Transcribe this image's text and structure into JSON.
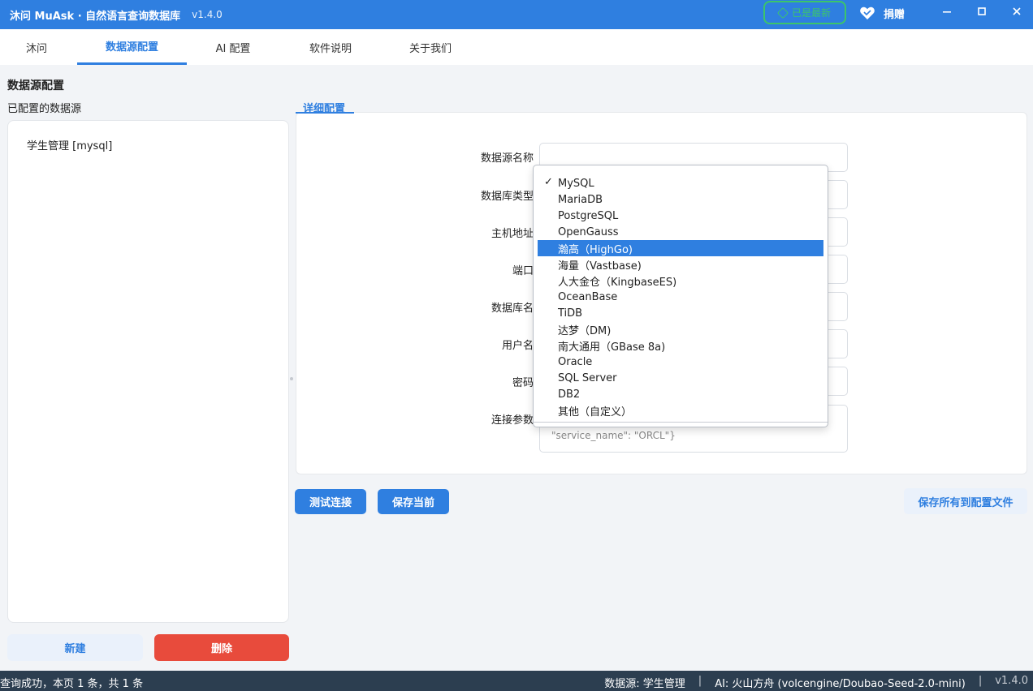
{
  "titlebar": {
    "title": "沐问 MuAsk · 自然语言查询数据库",
    "version": "v1.4.0",
    "update_badge": "已是最新",
    "donate_label": "捐赠"
  },
  "tabs": [
    {
      "label": "沐问"
    },
    {
      "label": "数据源配置"
    },
    {
      "label": "AI 配置"
    },
    {
      "label": "软件说明"
    },
    {
      "label": "关于我们"
    }
  ],
  "left": {
    "section_title": "数据源配置",
    "list_title": "已配置的数据源",
    "items": [
      {
        "label": "学生管理 [mysql]"
      }
    ],
    "new_button": "新建",
    "delete_button": "删除"
  },
  "detail": {
    "group_title": "详细配置",
    "labels": {
      "name": "数据源名称",
      "db_type": "数据库类型",
      "host": "主机地址",
      "port": "端口",
      "db_name": "数据库名",
      "username": "用户名",
      "password": "密码",
      "params": "连接参数"
    },
    "params_placeholder": "\"service_name\": \"ORCL\"}"
  },
  "dropdown": {
    "selected": "MySQL",
    "highlighted": "瀚高（HighGo)",
    "options": [
      "MySQL",
      "MariaDB",
      "PostgreSQL",
      "OpenGauss",
      "瀚高（HighGo)",
      "海量（Vastbase)",
      "人大金仓（KingbaseES)",
      "OceanBase",
      "TiDB",
      "达梦（DM)",
      "南大通用（GBase 8a)",
      "Oracle",
      "SQL Server",
      "DB2",
      "其他（自定义）"
    ]
  },
  "actions": {
    "test_connection": "测试连接",
    "save_current": "保存当前",
    "save_all": "保存所有到配置文件"
  },
  "statusbar": {
    "message": "查询成功，本页 1 条，共 1 条",
    "datasource": "数据源: 学生管理",
    "ai": "AI: 火山方舟 (volcengine/Doubao-Seed-2.0-mini)",
    "version": "v1.4.0",
    "separator": "|"
  },
  "colors": {
    "primary": "#2f7fe0",
    "danger": "#e84b3c",
    "success": "#3cc56a",
    "statusbar": "#2c3e50"
  }
}
